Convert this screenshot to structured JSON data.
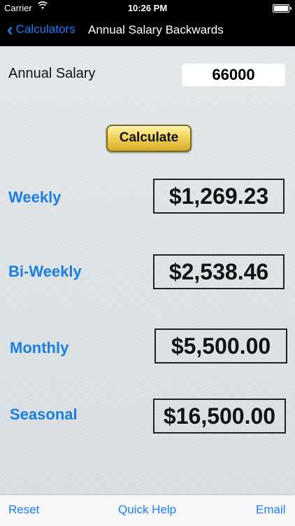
{
  "status_bar": {
    "carrier": "Carrier",
    "time": "10:26 PM"
  },
  "nav": {
    "back_label": "Calculators",
    "title": "Annual Salary Backwards"
  },
  "form": {
    "salary_label": "Annual Salary",
    "salary_value": "66000",
    "calculate_label": "Calculate"
  },
  "results": [
    {
      "label": "Weekly",
      "value": "$1,269.23"
    },
    {
      "label": "Bi-Weekly",
      "value": "$2,538.46"
    },
    {
      "label": "Monthly",
      "value": "$5,500.00"
    },
    {
      "label": "Seasonal",
      "value": "$16,500.00"
    }
  ],
  "toolbar": {
    "reset": "Reset",
    "quick_help": "Quick Help",
    "email": "Email"
  },
  "colors": {
    "accent": "#1a7cff",
    "label_blue": "#1a7fe0",
    "button_gold": "#f3d35c"
  }
}
